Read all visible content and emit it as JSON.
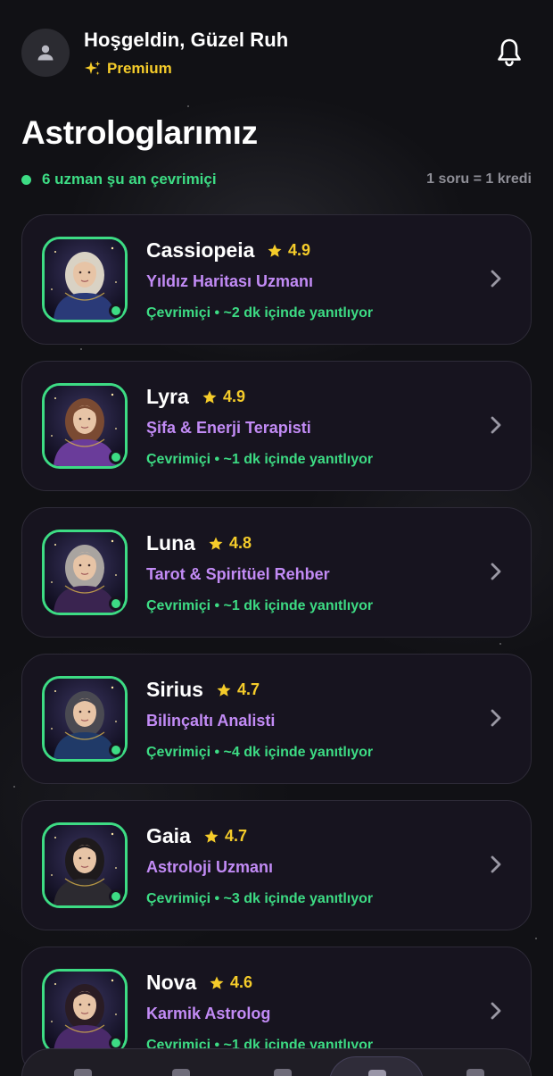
{
  "header": {
    "avatar_icon": "user-icon",
    "greeting": "Hoşgeldin, Güzel Ruh",
    "premium_label": "Premium",
    "premium_icon": "sparkle-icon",
    "notification_icon": "bell-icon"
  },
  "page": {
    "title": "Astrologlarımız",
    "online_summary": "6 uzman şu an çevrimiçi",
    "credit_info": "1 soru = 1 kredi"
  },
  "colors": {
    "background": "#111115",
    "card": "#17141f",
    "online_green": "#3ddc84",
    "rating_gold": "#f5cc2a",
    "specialty_purple": "#c28bf5"
  },
  "astrologers": [
    {
      "name": "Cassiopeia",
      "rating": "4.9",
      "specialty": "Yıldız Haritası Uzmanı",
      "status": "Çevrimiçi • ~2 dk içinde yanıtlıyor",
      "hair": "#d9d2c4",
      "robe": "#2a3a78"
    },
    {
      "name": "Lyra",
      "rating": "4.9",
      "specialty": "Şifa & Enerji Terapisti",
      "status": "Çevrimiçi • ~1 dk içinde yanıtlıyor",
      "hair": "#7a4a32",
      "robe": "#6a3c9a"
    },
    {
      "name": "Luna",
      "rating": "4.8",
      "specialty": "Tarot & Spiritüel Rehber",
      "status": "Çevrimiçi • ~1 dk içinde yanıtlıyor",
      "hair": "#a9a4a0",
      "robe": "#3a2450"
    },
    {
      "name": "Sirius",
      "rating": "4.7",
      "specialty": "Bilinçaltı Analisti",
      "status": "Çevrimiçi • ~4 dk içinde yanıtlıyor",
      "hair": "#4a4a52",
      "robe": "#203a68"
    },
    {
      "name": "Gaia",
      "rating": "4.7",
      "specialty": "Astroloji Uzmanı",
      "status": "Çevrimiçi • ~3 dk içinde yanıtlıyor",
      "hair": "#1e1a1c",
      "robe": "#2c2a30"
    },
    {
      "name": "Nova",
      "rating": "4.6",
      "specialty": "Karmik Astrolog",
      "status": "Çevrimiçi • ~1 dk içinde yanıtlıyor",
      "hair": "#2a1c24",
      "robe": "#4a2a6a"
    }
  ],
  "bottom_nav": {
    "icons": [
      "home-icon",
      "chat-icon",
      "star-icon",
      "astrologers-icon",
      "profile-icon"
    ],
    "active_index": 3
  }
}
